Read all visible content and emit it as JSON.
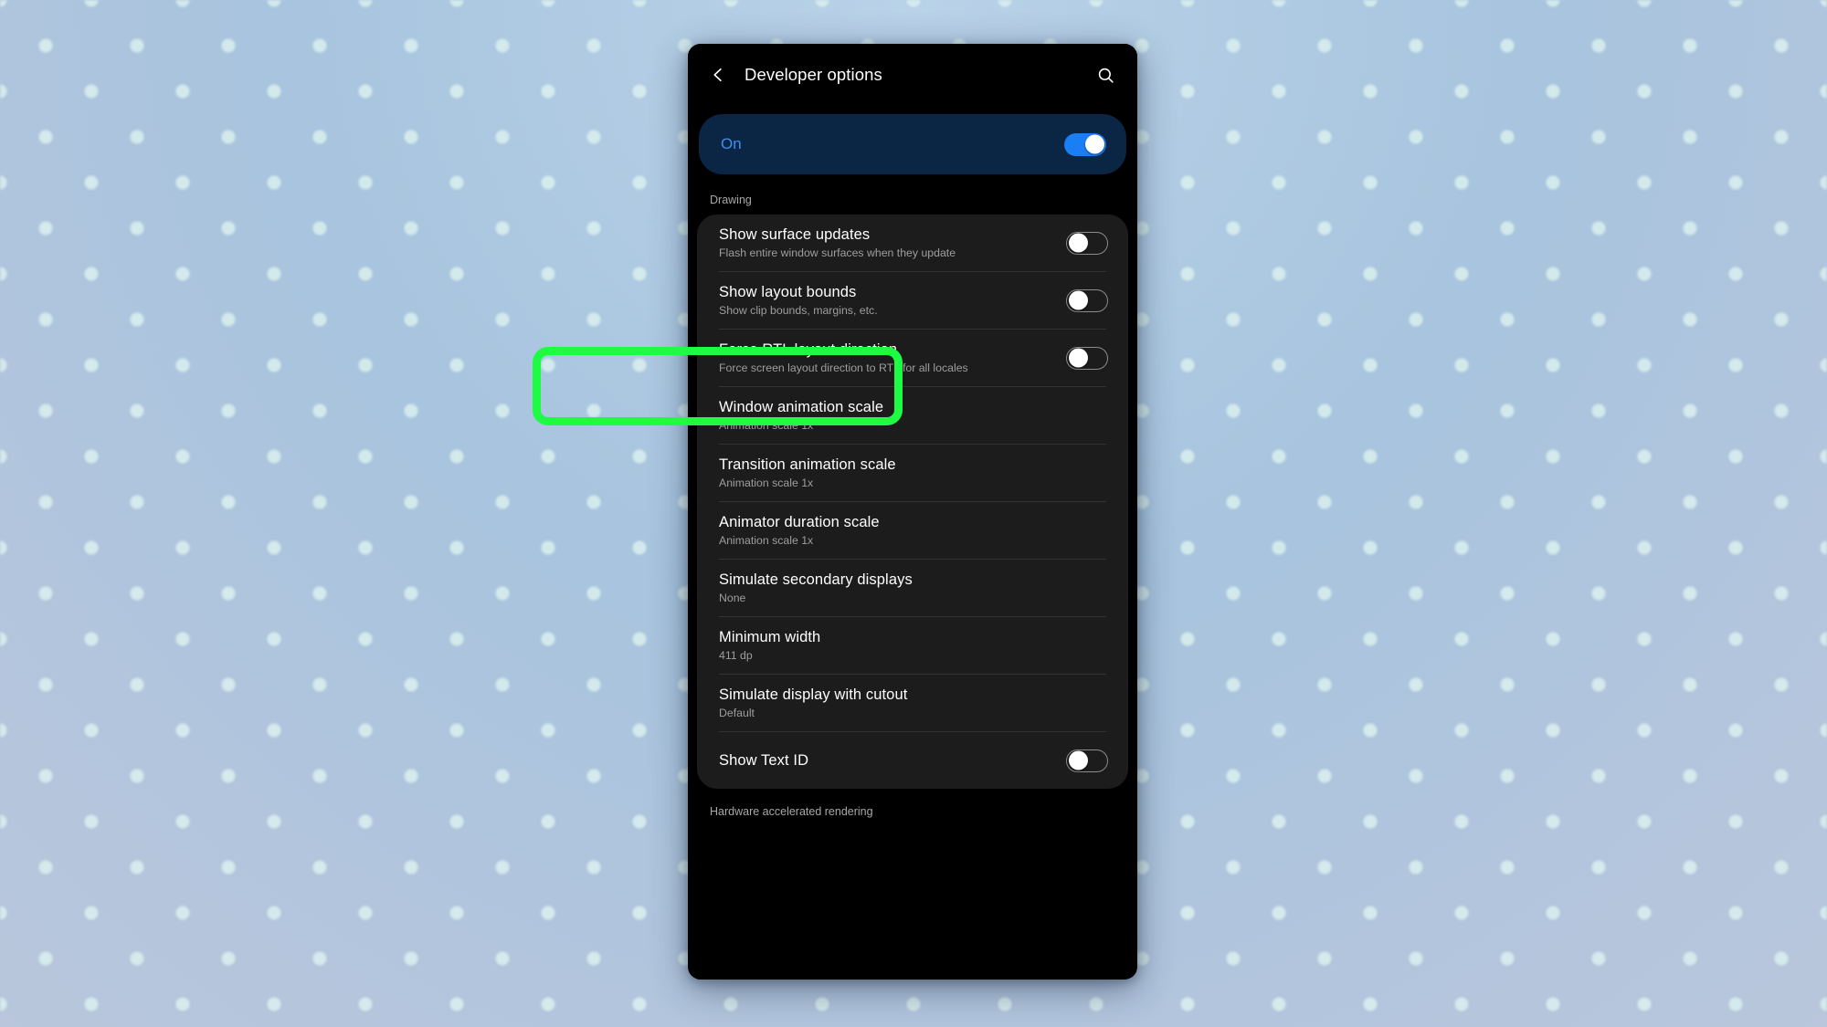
{
  "appbar": {
    "back_icon": "chevron-left-icon",
    "title": "Developer options",
    "search_icon": "search-icon"
  },
  "master_toggle": {
    "label": "On",
    "state": "on"
  },
  "sections": [
    {
      "header": "Drawing",
      "items": [
        {
          "title": "Show surface updates",
          "subtitle": "Flash entire window surfaces when they update",
          "control": "switch",
          "state": "off"
        },
        {
          "title": "Show layout bounds",
          "subtitle": "Show clip bounds, margins, etc.",
          "control": "switch",
          "state": "off"
        },
        {
          "title": "Force RTL layout direction",
          "subtitle": "Force screen layout direction to RTL for all locales",
          "control": "switch",
          "state": "off"
        },
        {
          "title": "Window animation scale",
          "subtitle": "Animation scale 1x",
          "control": "none",
          "highlighted": true
        },
        {
          "title": "Transition animation scale",
          "subtitle": "Animation scale 1x",
          "control": "none"
        },
        {
          "title": "Animator duration scale",
          "subtitle": "Animation scale 1x",
          "control": "none"
        },
        {
          "title": "Simulate secondary displays",
          "subtitle": "None",
          "control": "none"
        },
        {
          "title": "Minimum width",
          "subtitle": "411 dp",
          "control": "none"
        },
        {
          "title": "Simulate display with cutout",
          "subtitle": "Default",
          "control": "none"
        },
        {
          "title": "Show Text ID",
          "subtitle": "",
          "control": "switch",
          "state": "off"
        }
      ]
    },
    {
      "header": "Hardware accelerated rendering",
      "items": []
    }
  ],
  "colors": {
    "accent_blue": "#3d90f2",
    "toggle_on": "#1a7ef5",
    "banner_bg": "#0b2545",
    "card_bg": "#1c1c1c",
    "screen_bg": "#000000",
    "highlight_green": "#1dfc43",
    "subtitle_gray": "#9e9e9e"
  }
}
